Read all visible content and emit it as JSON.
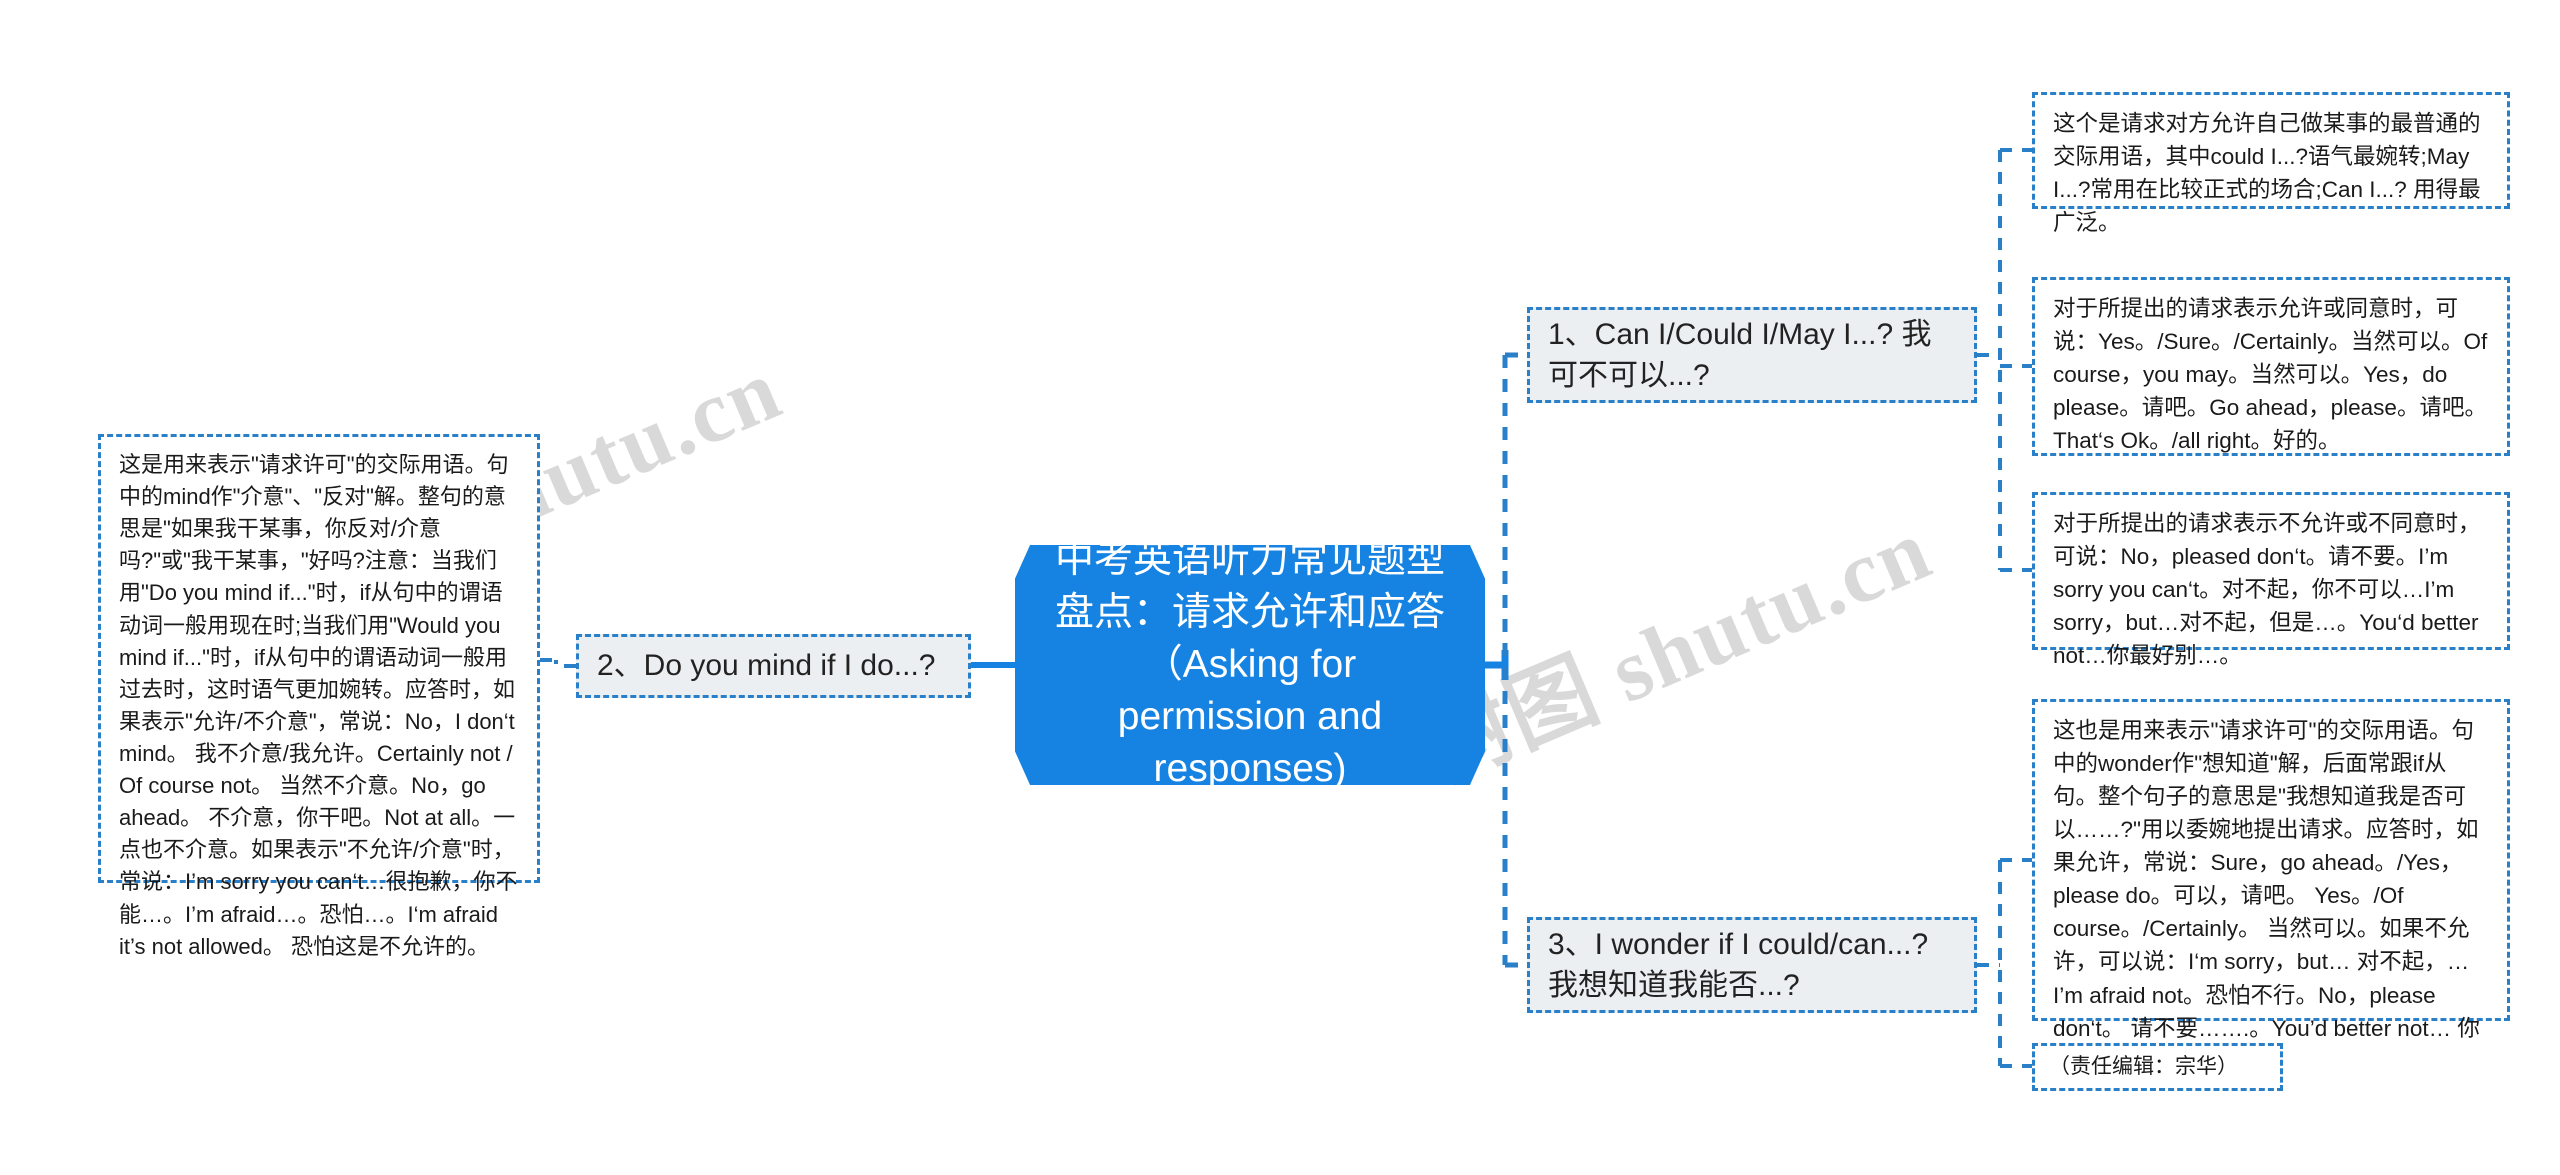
{
  "meta": {
    "watermark_1": "树图 shutu.cn",
    "watermark_2": "树图 shutu.cn",
    "accent_color": "#1683e2",
    "border_color": "#2a7fc9",
    "node_fill": "#eceff1",
    "canvas_background": "#ffffff"
  },
  "root": {
    "title": "中考英语听力常见题型盘点：请求允许和应答（Asking for permission and responses)"
  },
  "branches": {
    "left": {
      "topic": "2、Do you mind if I do...?",
      "detail": "这是用来表示\"请求许可\"的交际用语。句中的mind作\"介意\"、\"反对\"解。整句的意思是\"如果我干某事，你反对/介意吗?\"或\"我干某事，\"好吗?注意：当我们用\"Do you mind if...\"时，if从句中的谓语动词一般用现在时;当我们用\"Would you mind if...\"时，if从句中的谓语动词一般用过去时，这时语气更加婉转。应答时，如果表示\"允许/不介意\"，常说：No，I don‘t mind。 我不介意/我允许。Certainly not / Of course not。 当然不介意。No，go ahead。 不介意，你干吧。Not at all。一点也不介意。如果表示\"不允许/介意\"时，常说：I’m sorry you can‘t…很抱歉，你不能…。I’m afraid…。恐怕…。I‘m afraid it’s not allowed。 恐怕这是不允许的。"
    },
    "right": [
      {
        "topic": "1、Can I/Could I/May I...? 我可不可以...?",
        "details": [
          "这个是请求对方允许自己做某事的最普通的交际用语，其中could I...?语气最婉转;May I...?常用在比较正式的场合;Can I...? 用得最广泛。",
          "对于所提出的请求表示允许或同意时，可说：Yes。/Sure。/Certainly。当然可以。Of course，you may。当然可以。Yes，do please。请吧。Go ahead，please。请吧。That‘s Ok。/all right。好的。",
          "对于所提出的请求表示不允许或不同意时，可说：No，pleased don‘t。请不要。I’m sorry you can‘t。对不起，你不可以…I’m sorry，but…对不起，但是…。You‘d better not…你最好别…。"
        ]
      },
      {
        "topic": "3、I wonder if I could/can...? 我想知道我能否...?",
        "details": [
          "这也是用来表示\"请求许可\"的交际用语。句中的wonder作\"想知道\"解，后面常跟if从句。整个句子的意思是\"我想知道我是否可以……?\"用以委婉地提出请求。应答时，如果允许，常说：Sure，go ahead。/Yes，please do。可以，请吧。 Yes。/Of course。/Certainly。 当然可以。如果不允许，可以说：I‘m sorry，but… 对不起，…I’m afraid not。恐怕不行。No，please don‘t。 请不要…….。You’d better not… 你最好别…。。",
          "（责任编辑：宗华）"
        ]
      }
    ]
  }
}
